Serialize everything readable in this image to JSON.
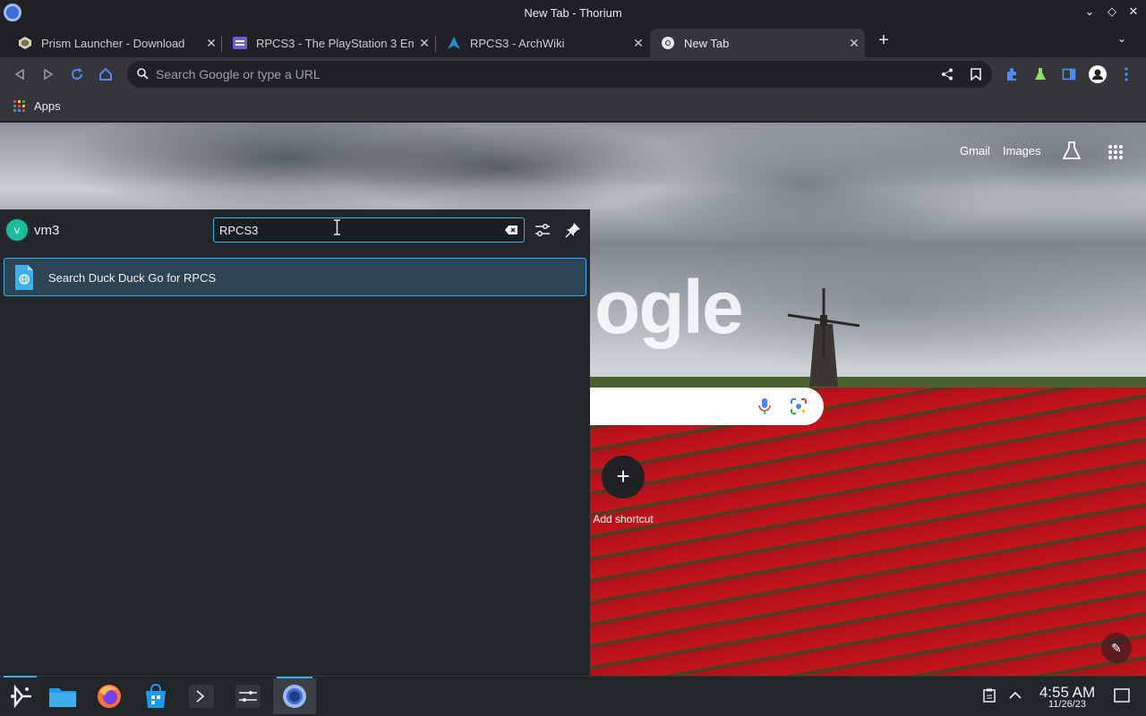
{
  "window": {
    "title": "New Tab - Thorium"
  },
  "tabs": [
    {
      "label": "Prism Launcher - Download",
      "icon": "prism-launcher-icon"
    },
    {
      "label": "RPCS3 - The PlayStation 3 Em",
      "icon": "rpcs3-icon"
    },
    {
      "label": "RPCS3 - ArchWiki",
      "icon": "arch-linux-icon"
    },
    {
      "label": "New Tab",
      "icon": "chrome-icon"
    }
  ],
  "omnibox": {
    "placeholder": "Search Google or type a URL"
  },
  "bookmarks": {
    "apps_label": "Apps"
  },
  "ntp": {
    "gmail": "Gmail",
    "images": "Images",
    "logo_text": "ogle",
    "add_shortcut": "Add shortcut",
    "add_glyph": "+"
  },
  "launcher": {
    "avatar_letter": "V",
    "username": "vm3",
    "query": "RPCS3",
    "result": "Search Duck Duck Go for RPCS"
  },
  "taskbar": {
    "time": "4:55 AM",
    "date": "11/26/23"
  },
  "colors": {
    "accent": "#3daee9",
    "avatar": "#1abc9c",
    "browser_bg": "#202124",
    "toolbar_bg": "#35363a",
    "launcher_bg": "#232629"
  }
}
